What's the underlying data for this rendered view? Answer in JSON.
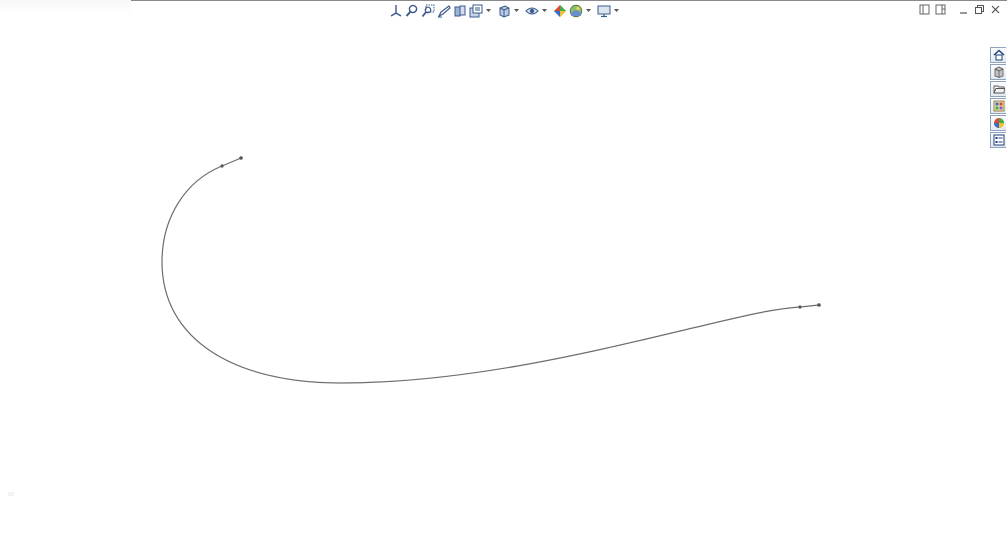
{
  "window": {
    "title": ""
  },
  "heads_up_toolbar": {
    "items": [
      {
        "icon": "view-orientation-icon",
        "has_dropdown": false
      },
      {
        "icon": "zoom-to-fit-icon",
        "has_dropdown": false
      },
      {
        "icon": "zoom-to-area-icon",
        "has_dropdown": false
      },
      {
        "icon": "previous-view-icon",
        "has_dropdown": false
      },
      {
        "icon": "section-view-icon",
        "has_dropdown": false
      },
      {
        "icon": "dynamic-annotation-views-icon",
        "has_dropdown": true
      },
      {
        "icon": "view-orientation-cube-icon",
        "has_dropdown": true
      },
      {
        "icon": "hide-show-items-icon",
        "has_dropdown": true
      },
      {
        "icon": "edit-appearance-icon",
        "has_dropdown": false
      },
      {
        "icon": "apply-scene-icon",
        "has_dropdown": true
      },
      {
        "icon": "view-settings-icon",
        "has_dropdown": true
      }
    ]
  },
  "window_controls": [
    {
      "icon": "tile-horizontal-icon"
    },
    {
      "icon": "tile-vertical-icon"
    },
    {
      "icon": "minimize-icon"
    },
    {
      "icon": "restore-icon"
    },
    {
      "icon": "close-icon"
    }
  ],
  "task_pane": {
    "tabs": [
      {
        "icon": "home-icon"
      },
      {
        "icon": "design-library-icon"
      },
      {
        "icon": "file-explorer-icon"
      },
      {
        "icon": "view-palette-icon"
      },
      {
        "icon": "appearances-scenes-icon"
      },
      {
        "icon": "custom-properties-icon"
      }
    ]
  },
  "sketch": {
    "entity": "spline",
    "stroke_color": "#6e6e6e",
    "point_color": "#555555"
  }
}
